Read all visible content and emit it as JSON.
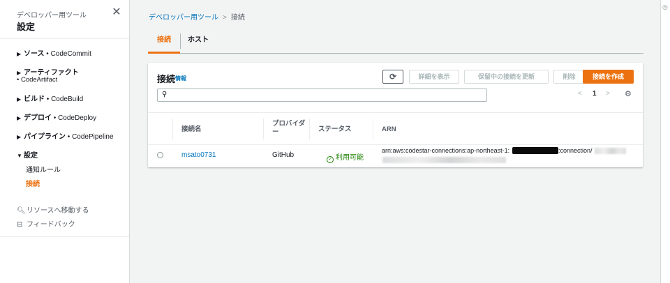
{
  "sidebar": {
    "subtitle": "デベロッパー用ツール",
    "title": "設定",
    "groups": [
      {
        "label": "ソース",
        "service": "CodeCommit"
      },
      {
        "label": "アーティファクト",
        "service": "CodeArtifact"
      },
      {
        "label": "ビルド",
        "service": "CodeBuild"
      },
      {
        "label": "デプロイ",
        "service": "CodeDeploy"
      },
      {
        "label": "パイプライン",
        "service": "CodePipeline"
      },
      {
        "label": "設定"
      }
    ],
    "settings_children": [
      "通知ルール",
      "接続"
    ],
    "utilities": [
      "リソースへ移動する",
      "フィードバック"
    ],
    "icons": {
      "close": "close-icon",
      "collapsed": "triangle-right-icon",
      "expanded": "triangle-down-icon",
      "search": "search-icon",
      "feedback": "feedback-icon"
    }
  },
  "breadcrumb": {
    "parent": "デベロッパー用ツール",
    "current": "接続"
  },
  "tabs": [
    {
      "label": "接続",
      "active": true
    },
    {
      "label": "ホスト",
      "active": false
    }
  ],
  "panel": {
    "title": "接続",
    "info": "情報",
    "buttons": {
      "refresh": "refresh-icon",
      "details": "詳細を表示",
      "update_pending": "保留中の接続を更新",
      "delete": "削除",
      "create": "接続を作成"
    },
    "search": {
      "value": "",
      "placeholder": ""
    },
    "pagination": {
      "page": "1"
    },
    "columns": [
      "接続名",
      "プロバイダー",
      "ステータス",
      "ARN"
    ],
    "rows": [
      {
        "name": "msato0731",
        "provider": "GitHub",
        "status": "利用可能",
        "arn_prefix": "arn:aws:codestar-connections:ap-northeast-1:",
        "arn_mid": ":connection/"
      }
    ]
  },
  "colors": {
    "accent": "#ec7211",
    "link": "#0073bb",
    "success": "#1d8102",
    "text": "#16191f",
    "background": "#f2f3f3"
  }
}
